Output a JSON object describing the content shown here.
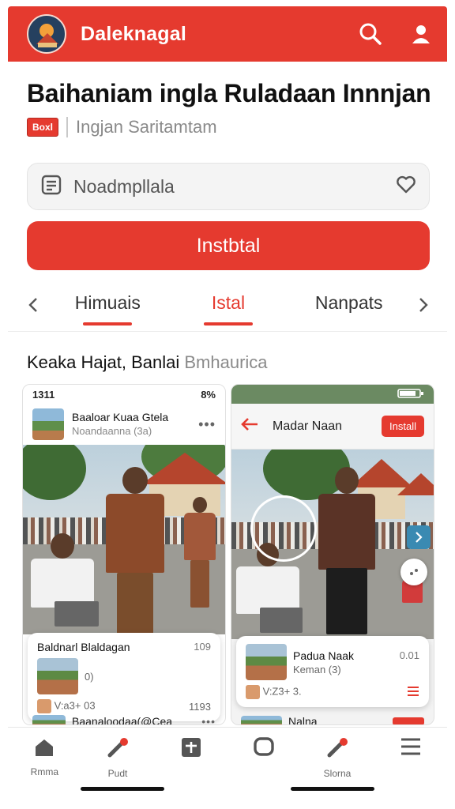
{
  "app": {
    "title": "Daleknagal",
    "accent": "#e53a2f"
  },
  "header": {
    "headline": "Baihaniam ingla Ruladaan Innnjan",
    "tag": "Boxl",
    "subtitle": "Ingjan Saritamtam"
  },
  "search": {
    "placeholder": "Noadmpllala",
    "icon": "list-icon",
    "favorite_icon": "heart-icon"
  },
  "install_button": {
    "label": "Instbtal"
  },
  "tabs": {
    "items": [
      {
        "label": "Himuais",
        "active": false
      },
      {
        "label": "Istal",
        "active": true
      },
      {
        "label": "Nanpats",
        "active": false
      }
    ]
  },
  "section": {
    "title_main": "Keaka Hajat, Banlai",
    "title_muted": "Bmhaurica"
  },
  "phone_left": {
    "status_time": "1311",
    "status_battery": "8%",
    "post_name": "Baaloar Kuaa Gtela",
    "post_sub": "Noandaanna (3a)",
    "card_title": "Baldnarl Blaldagan",
    "card_num": "109",
    "card_sub": "0)",
    "card_meta_left": "V:a3+ 03",
    "card_meta_right": "1193",
    "footer_label": "Baanaloodaa(@Cea"
  },
  "phone_right": {
    "app_title": "Madar Naan",
    "install_label": "Install",
    "card_title": "Padua Naak",
    "card_num": "0.01",
    "card_sub": "Keman (3)",
    "card_meta": "V:Z3+ 3.",
    "footer_label": "Nalna"
  },
  "bottom_nav": {
    "items": [
      {
        "label": "Rmma",
        "icon": "home-icon"
      },
      {
        "label": "Pudt",
        "icon": "pencil-icon"
      },
      {
        "label": "",
        "icon": "plus-square-icon"
      },
      {
        "label": "",
        "icon": "chat-bubble-icon"
      },
      {
        "label": "Slorna",
        "icon": "pencil-badge-icon"
      },
      {
        "label": "",
        "icon": "menu-icon"
      }
    ]
  }
}
